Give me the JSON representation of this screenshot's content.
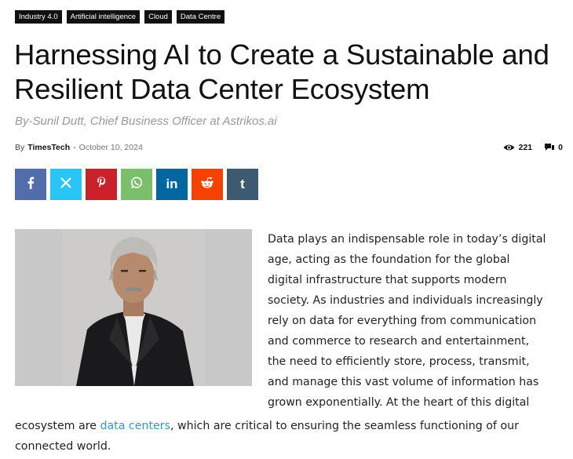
{
  "tags": [
    "Industry 4.0",
    "Artificial intelligence",
    "Cloud",
    "Data Centre"
  ],
  "title": "Harnessing AI to Create a Sustainable and Resilient Data Center Ecosystem",
  "subtitle": "By-Sunil Dutt, Chief Business Officer at Astrikos.ai",
  "meta": {
    "by_label": "By",
    "author": "TimesTech",
    "separator": "-",
    "date": "October 10, 2024",
    "views": "221",
    "comments": "0"
  },
  "share": [
    {
      "name": "facebook",
      "glyph": "f",
      "color": "#516eab"
    },
    {
      "name": "x",
      "glyph": "𝕏",
      "color": "#29c5f6"
    },
    {
      "name": "pinterest",
      "glyph": "p",
      "color": "#ca212a"
    },
    {
      "name": "whatsapp",
      "glyph": "w",
      "color": "#7bbf6a"
    },
    {
      "name": "linkedin",
      "glyph": "in",
      "color": "#0266a0"
    },
    {
      "name": "reddit",
      "glyph": "r",
      "color": "#f54200"
    },
    {
      "name": "tumblr",
      "glyph": "t",
      "color": "#3e5a70"
    }
  ],
  "article": {
    "col_lines": [
      "Data plays an indispensable role in today’s digital",
      "age, acting as the foundation for the global",
      "digital infrastructure that supports modern",
      "society. As industries and individuals increasingly",
      "rely on data for everything from communication",
      "and commerce to research and entertainment,",
      "the need to efficiently store, process, transmit,",
      "and manage this vast volume of information has",
      "grown exponentially. At the heart of this digital"
    ],
    "full_line_before": "ecosystem are ",
    "link_text": "data centers",
    "full_line_after": ", which are critical to ensuring the seamless functioning of our",
    "last_line": "connected world."
  },
  "colors": {
    "tag_bg": "#111111",
    "link": "#2c9bd4",
    "subtitle": "#999999"
  }
}
